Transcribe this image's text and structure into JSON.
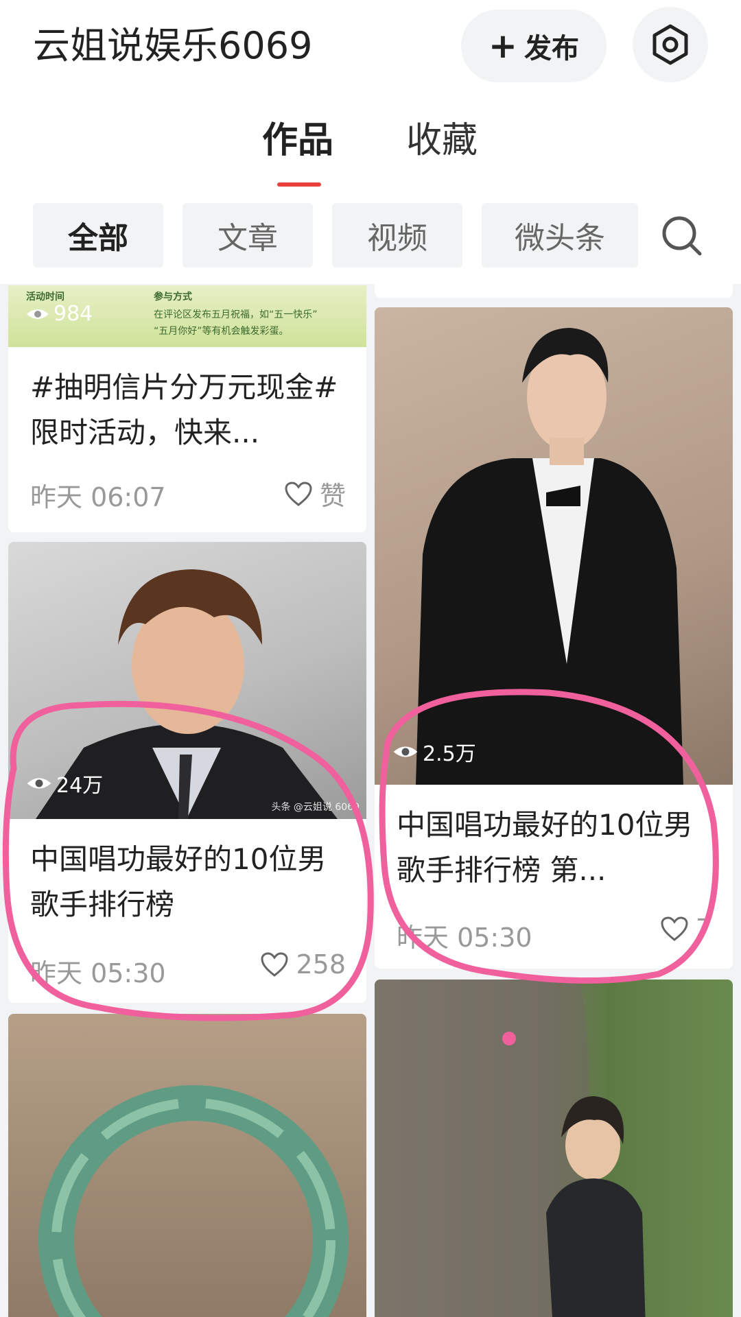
{
  "header": {
    "title": "云姐说娱乐6069",
    "publish_label": "发布",
    "tabs": [
      {
        "label": "作品",
        "active": true
      },
      {
        "label": "收藏",
        "active": false
      }
    ]
  },
  "filters": {
    "chips": [
      {
        "label": "全部",
        "active": true
      },
      {
        "label": "文章",
        "active": false
      },
      {
        "label": "视频",
        "active": false
      },
      {
        "label": "微头条",
        "active": false
      }
    ]
  },
  "feed": {
    "left": [
      {
        "banner_texts": [
          "活动时间",
          "参与方式",
          "在评论区发布五月祝福，如“五一快乐”",
          "“五月你好”等有机会触发彩蛋。"
        ],
        "views": "984",
        "title": "#抽明信片分万元现金#限时活动，快来...",
        "time": "昨天  06:07",
        "likes": "赞"
      },
      {
        "views": "24万",
        "watermark": "头条 @云姐说 6069",
        "title": "中国唱功最好的10位男歌手排行榜",
        "time": "昨天  05:30",
        "likes": "258"
      }
    ],
    "right": [
      {
        "views": "2.5万",
        "title": "中国唱功最好的10位男歌手排行榜 第...",
        "time": "昨天  05:30",
        "likes": "7"
      }
    ]
  },
  "colors": {
    "accent": "#e8403a",
    "annotation": "#f0609c",
    "background": "#f2f3f5"
  }
}
